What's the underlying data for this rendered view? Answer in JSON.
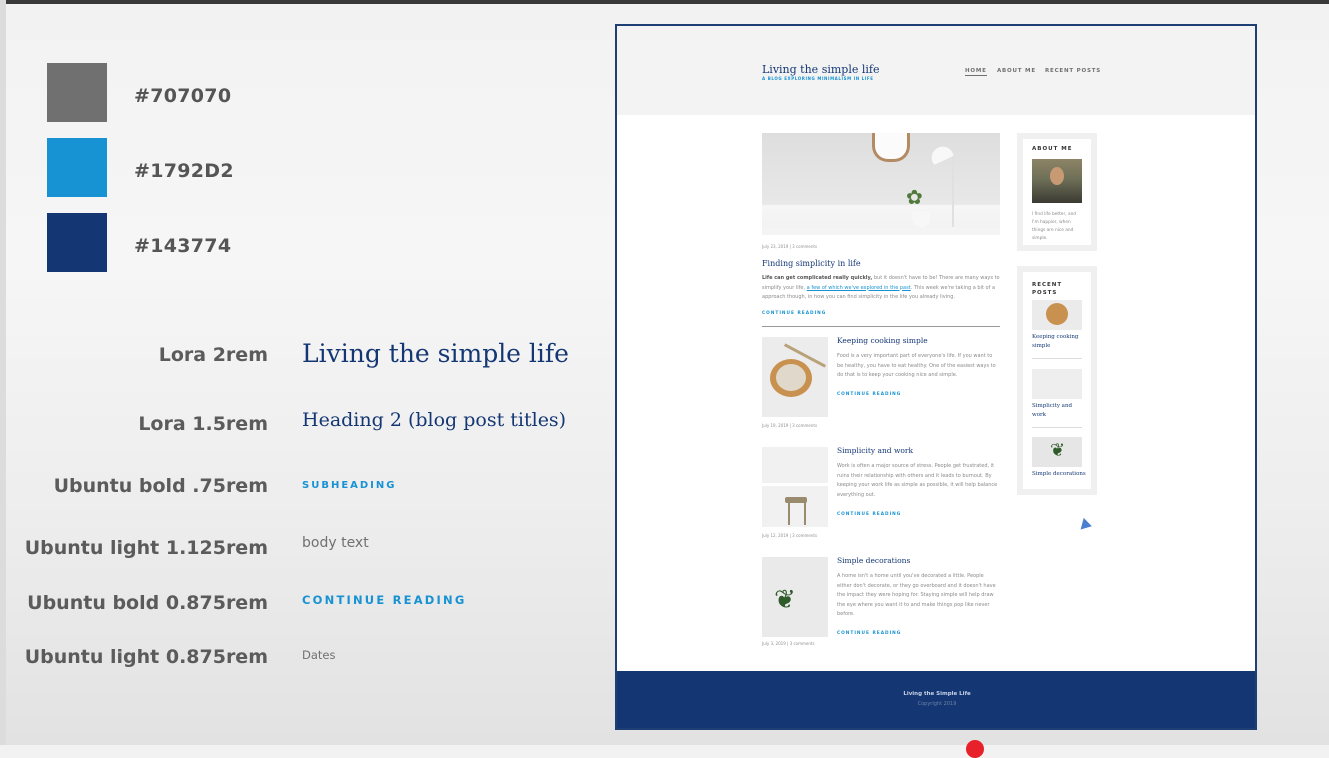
{
  "style_guide": {
    "colors": [
      {
        "hex": "#707070",
        "label": "#707070"
      },
      {
        "hex": "#1792D2",
        "label": "#1792D2"
      },
      {
        "hex": "#143774",
        "label": "#143774"
      }
    ],
    "typography": [
      {
        "label": "Lora 2rem",
        "sample": "Living the simple life"
      },
      {
        "label": "Lora 1.5rem",
        "sample": "Heading 2 (blog post titles)"
      },
      {
        "label": "Ubuntu bold .75rem",
        "sample": "SUBHEADING"
      },
      {
        "label": "Ubuntu light 1.125rem",
        "sample": "body text"
      },
      {
        "label": "Ubuntu bold 0.875rem",
        "sample": "CONTINUE READING"
      },
      {
        "label": "Ubuntu light 0.875rem",
        "sample": "Dates"
      }
    ]
  },
  "mockup": {
    "site_title": "Living the simple life",
    "tagline": "A BLOG EXPLORING MINIMALISM IN LIFE",
    "nav": [
      "HOME",
      "ABOUT ME",
      "RECENT POSTS"
    ],
    "featured": {
      "meta": "July 23, 2019  |  3 comments",
      "title": "Finding simplicity in life",
      "excerpt_bold": "Life can get complicated really quickly,",
      "excerpt_a": " but it doesn't have to be! There are many ways to simplify your life,",
      "excerpt_link": "a few of which we've explored in the past",
      "excerpt_b": ". This week we're taking a bit of a approach though, in how you can find simplicity in the life you already living.",
      "continue": "CONTINUE READING"
    },
    "posts": [
      {
        "title": "Keeping cooking simple",
        "excerpt": "Food is a very important part of everyone's life. If you want to be healthy, you have to eat healthy. One of the easiest ways to do that is to keep your cooking nice and simple.",
        "continue": "CONTINUE READING",
        "meta": "July 19, 2019  |  3 comments"
      },
      {
        "title": "Simplicity and work",
        "excerpt": "Work is often a major source of stress. People get frustrated, it ruins their relationship with others and it leads to burnout. By keeping your work life as simple as possible, it will help balance everything out.",
        "continue": "CONTINUE READING",
        "meta": "July 12, 2019  |  3 comments"
      },
      {
        "title": "Simple decorations",
        "excerpt": "A home isn't a home until you've decorated a little. People either don't decorate, or they go overboard and it doesn't have the impact they were hoping for. Staying simple will help draw the eye where you want it to and make things pop like never before.",
        "continue": "CONTINUE READING",
        "meta": "July 3, 2019  |  3 comments"
      }
    ],
    "sidebar": {
      "about_title": "ABOUT ME",
      "about_text": "I find life better, and I'm happier, when things are nice and simple.",
      "recent_title": "RECENT POSTS",
      "recent": [
        "Keeping cooking simple",
        "Simplicity and work",
        "Simple decorations"
      ]
    },
    "footer": {
      "title": "Living the Simple Life",
      "copyright": "Copyright 2019"
    }
  }
}
